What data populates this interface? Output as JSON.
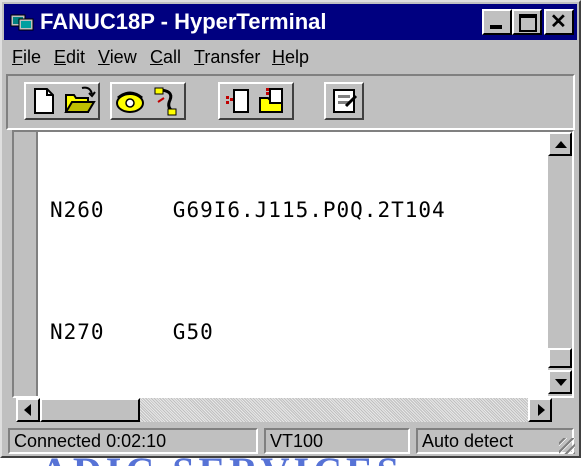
{
  "window": {
    "title": "FANUC18P - HyperTerminal"
  },
  "menu": [
    {
      "label": "File",
      "accel": "F",
      "rest": "ile"
    },
    {
      "label": "Edit",
      "accel": "E",
      "rest": "dit"
    },
    {
      "label": "View",
      "accel": "V",
      "rest": "iew"
    },
    {
      "label": "Call",
      "accel": "C",
      "rest": "all"
    },
    {
      "label": "Transfer",
      "accel": "T",
      "rest": "ransfer"
    },
    {
      "label": "Help",
      "accel": "H",
      "rest": "elp"
    }
  ],
  "toolbar": [
    "new-icon",
    "open-icon",
    "call-icon",
    "disconnect-icon",
    "send-icon",
    "receive-icon",
    "properties-icon"
  ],
  "terminal": {
    "lines": [
      {
        "label": "N260",
        "code": "G69I6.J115.P0Q.2T104"
      },
      {
        "label": "N270",
        "code": "G50"
      }
    ]
  },
  "status": {
    "connected": "Connected 0:02:10",
    "emulation": "VT100",
    "detect": "Auto detect"
  },
  "watermark": "ADIC SERVICES",
  "colors": {
    "titlebar": "#000080",
    "chrome": "#c0c0c0",
    "watermark": "#3a5bd0"
  }
}
